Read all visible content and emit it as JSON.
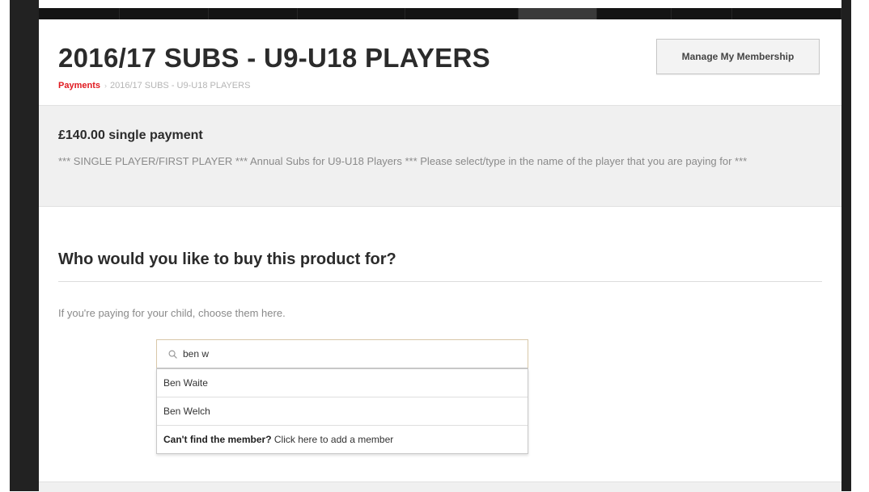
{
  "header": {
    "title": "2016/17 SUBS - U9-U18 PLAYERS",
    "manage_button": "Manage My Membership"
  },
  "breadcrumb": {
    "link": "Payments",
    "separator": "›",
    "current": "2016/17 SUBS - U9-U18 PLAYERS"
  },
  "product": {
    "price": "£140.00 single payment",
    "description": "*** SINGLE PLAYER/FIRST PLAYER *** Annual Subs for U9-U18 Players *** Please select/type in the name of the player that you are paying for ***"
  },
  "buy_for": {
    "heading": "Who would you like to buy this product for?",
    "hint": "If you're paying for your child, choose them here."
  },
  "search": {
    "value": "ben w",
    "icon": "search-icon"
  },
  "dropdown": {
    "results": [
      "Ben Waite",
      "Ben Welch"
    ],
    "footer_strong": "Can't find the member?",
    "footer_link": "Click here to add a member"
  }
}
